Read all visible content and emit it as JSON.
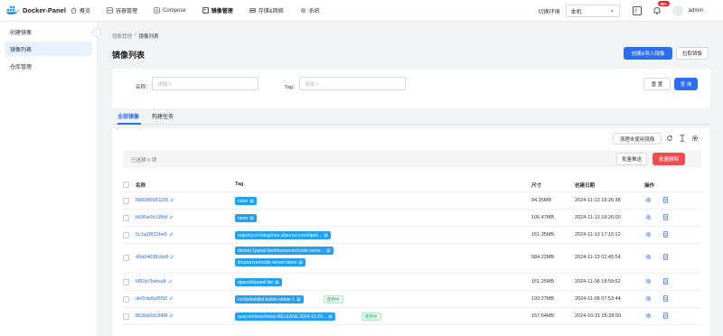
{
  "app": {
    "name": "Docker-Panel"
  },
  "nav": [
    {
      "label": "概览",
      "icon": "home-icon"
    },
    {
      "label": "容器管理",
      "icon": "container-icon"
    },
    {
      "label": "Compose",
      "icon": "compose-icon"
    },
    {
      "label": "镜像管理",
      "icon": "image-icon"
    },
    {
      "label": "存储&网络",
      "icon": "storage-icon"
    },
    {
      "label": "系统",
      "icon": "gear-icon"
    }
  ],
  "header": {
    "env_label": "切换环境",
    "env_value": "本机",
    "notification_count": "99+",
    "username": "admin"
  },
  "sidebar": {
    "items": [
      {
        "label": "创建镜像"
      },
      {
        "label": "镜像列表"
      },
      {
        "label": "仓库管理"
      }
    ]
  },
  "breadcrumb": {
    "parent": "镜像管理",
    "sep": "/",
    "current": "镜像列表"
  },
  "page": {
    "title": "镜像列表"
  },
  "actions": {
    "create_import": "创建&导入镜像",
    "pull": "拉取镜像"
  },
  "search": {
    "name_label": "名称",
    "name_placeholder": "请输入",
    "tag_label": "Tag",
    "tag_placeholder": "请输入",
    "reset": "重 置",
    "query": "查 询"
  },
  "tabs": [
    {
      "label": "全部镜像"
    },
    {
      "label": "构建任务"
    }
  ],
  "toolbar": {
    "clean_unused": "清理未使用镜像"
  },
  "selection": {
    "text": "已选择 0 项",
    "batch_push": "批量推送",
    "batch_delete": "批量删除"
  },
  "table": {
    "columns": {
      "name": "名称",
      "tag": "Tag",
      "size": "尺寸",
      "created": "创建日期",
      "ops": "操作"
    },
    "in_use_label": "使用中",
    "rows": [
      {
        "name": "588286681105",
        "tags": [
          "none"
        ],
        "in_use": false,
        "size": "94.35MB",
        "created": "2024-11-13 18:26:38"
      },
      {
        "name": "b686e0b198bf",
        "tags": [
          "none"
        ],
        "in_use": false,
        "size": "106.47MB",
        "created": "2024-11-13 18:26:00"
      },
      {
        "name": "5c1a28f22be5",
        "tags": [
          "registry.cn-hangzhou.aliyuncs.com/dpan..."
        ],
        "in_use": false,
        "size": "151.35MB",
        "created": "2024-11-13 17:15:12"
      },
      {
        "name": "40a04038cbb8",
        "tags": [
          "docker.1panel.live/linuxserver/code-serve...",
          "linuxserver/code-server:latest"
        ],
        "in_use": false,
        "size": "584.22MB",
        "created": "2024-11-13 01:45:54"
      },
      {
        "name": "6f81b7befea8",
        "tags": [
          "dpanel/dpanel:lite"
        ],
        "in_use": false,
        "size": "151.25MB",
        "created": "2024-11-08 18:50:52"
      },
      {
        "name": "def2de8a9550",
        "tags": [
          "moby/buildkit:buildx-stable-1"
        ],
        "in_use": true,
        "size": "193.27MB",
        "created": "2024-11-08 07:53:44"
      },
      {
        "name": "802bb0d1848f",
        "tags": [
          "quay.io/minio/minio:RELEASE.2024-10-29..."
        ],
        "in_use": true,
        "size": "157.64MB",
        "created": "2024-10-31 05:28:59"
      }
    ]
  },
  "colors": {
    "primary": "#2b6ef2",
    "tag": "#1fa0f0",
    "danger": "#f04e4e",
    "success": "#27ae60"
  }
}
